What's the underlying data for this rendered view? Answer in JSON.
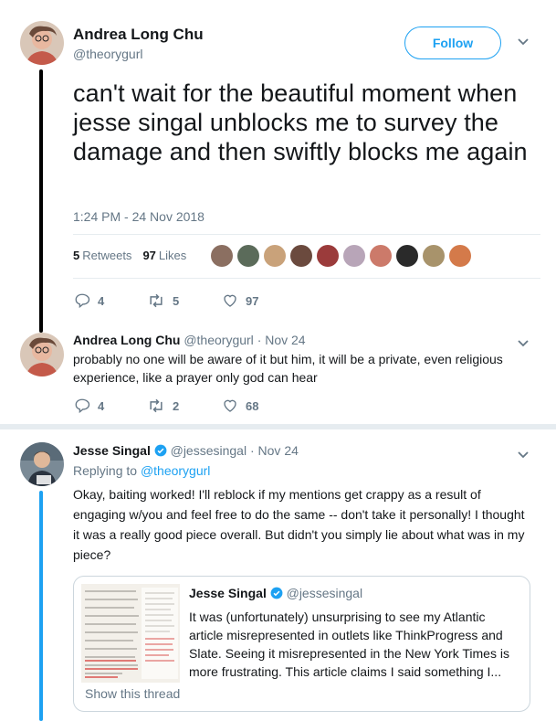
{
  "main_tweet": {
    "author_name": "Andrea Long Chu",
    "author_handle": "@theorygurl",
    "follow_label": "Follow",
    "text": "can't wait for the beautiful moment when jesse singal unblocks me to survey the damage and then swiftly blocks me again",
    "timestamp": "1:24 PM - 24 Nov 2018",
    "retweets_count": "5",
    "retweets_label": "Retweets",
    "likes_count": "97",
    "likes_label": "Likes",
    "actions": {
      "replies": "4",
      "retweets": "5",
      "likes": "97"
    },
    "liker_colors": [
      "#8b6f61",
      "#5b6b5a",
      "#c9a27a",
      "#6b4a3e",
      "#9b3b3b",
      "#b8a5b8",
      "#cc7a6a",
      "#2a2a2a",
      "#a8936b",
      "#d47a4a"
    ]
  },
  "reply_tweet": {
    "author_name": "Andrea Long Chu",
    "author_handle": "@theorygurl",
    "date": "· Nov 24",
    "text": "probably no one will be aware of it but him, it will be a private, even religious experience, like a prayer only god can hear",
    "actions": {
      "replies": "4",
      "retweets": "2",
      "likes": "68"
    }
  },
  "jesse_tweet": {
    "author_name": "Jesse Singal",
    "author_handle": "@jessesingal",
    "date": "· Nov 24",
    "replying_prefix": "Replying to",
    "replying_to": "@theorygurl",
    "text": "Okay, baiting worked! I'll reblock if my mentions get crappy as a result of engaging w/you and feel free to do the same -- don't take it personally! I thought it was a really good piece overall. But didn't you simply lie about what was in my piece?",
    "quote": {
      "author_name": "Jesse Singal",
      "author_handle": "@jessesingal",
      "text": "It was (unfortunately) unsurprising to see my Atlantic article misrepresented in outlets like ThinkProgress and Slate. Seeing it misrepresented in the New York Times is more frustrating. This article claims I said something I...",
      "show_thread": "Show this thread"
    }
  },
  "colors": {
    "accent": "#1da1f2",
    "muted": "#657786",
    "thread_line_dark": "#000000",
    "thread_line_blue": "#1da1f2"
  }
}
